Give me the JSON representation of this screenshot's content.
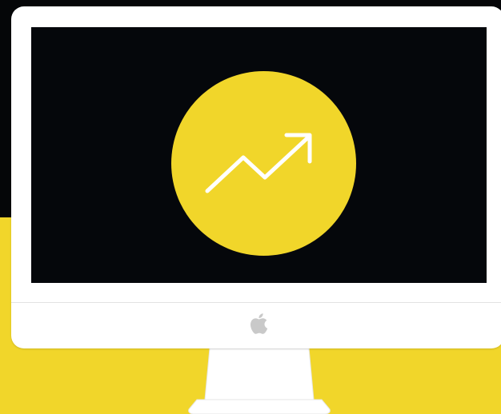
{
  "scene": {
    "device": "desktop-monitor",
    "screen_icon": "trending-up-arrow-icon",
    "brand_icon": "apple-logo-icon"
  },
  "colors": {
    "accent_yellow": "#f1d62a",
    "background_dark": "#050608",
    "screen_black": "#05070b",
    "monitor_white": "#ffffff",
    "logo_gray": "#c9c9c9"
  }
}
